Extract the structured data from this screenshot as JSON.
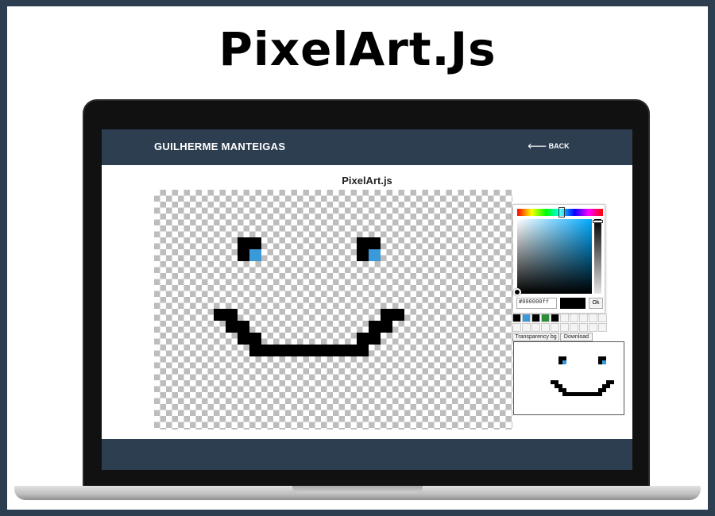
{
  "hero": {
    "title": "PixelArt.Js"
  },
  "nav": {
    "brand": "GUILHERME MANTEIGAS",
    "back_label": "🡐 BACK"
  },
  "app": {
    "title": "PixelArt.js"
  },
  "picker": {
    "hex_value": "#000000ff",
    "ok_label": "Ok",
    "transparency_label": "Transparency bg",
    "download_label": "Download",
    "palette": [
      "#000000",
      "#3a9ad9",
      "#000000",
      "#2e8b3a",
      "#000000",
      "#ffffff",
      "#ffffff",
      "#ffffff",
      "#ffffff",
      "#ffffff",
      "#ffffff",
      "#ffffff",
      "#ffffff",
      "#ffffff",
      "#ffffff",
      "#ffffff",
      "#ffffff",
      "#ffffff",
      "#ffffff",
      "#ffffff"
    ]
  },
  "colors": {
    "nav": "#2c3e50",
    "pixel_black": "#000000",
    "pixel_blue": "#3a9ad9"
  },
  "drawing": {
    "cell": "px",
    "pixels": [
      [
        7,
        4,
        "k"
      ],
      [
        8,
        4,
        "k"
      ],
      [
        7,
        5,
        "k"
      ],
      [
        8,
        5,
        "b"
      ],
      [
        17,
        4,
        "k"
      ],
      [
        18,
        4,
        "k"
      ],
      [
        17,
        5,
        "k"
      ],
      [
        18,
        5,
        "b"
      ],
      [
        5,
        10,
        "k"
      ],
      [
        6,
        10,
        "k"
      ],
      [
        6,
        11,
        "k"
      ],
      [
        7,
        11,
        "k"
      ],
      [
        7,
        12,
        "k"
      ],
      [
        8,
        12,
        "k"
      ],
      [
        8,
        13,
        "k"
      ],
      [
        9,
        13,
        "k"
      ],
      [
        10,
        13,
        "k"
      ],
      [
        11,
        13,
        "k"
      ],
      [
        12,
        13,
        "k"
      ],
      [
        13,
        13,
        "k"
      ],
      [
        14,
        13,
        "k"
      ],
      [
        15,
        13,
        "k"
      ],
      [
        16,
        13,
        "k"
      ],
      [
        17,
        13,
        "k"
      ],
      [
        17,
        12,
        "k"
      ],
      [
        18,
        12,
        "k"
      ],
      [
        18,
        11,
        "k"
      ],
      [
        19,
        11,
        "k"
      ],
      [
        19,
        10,
        "k"
      ],
      [
        20,
        10,
        "k"
      ]
    ]
  }
}
